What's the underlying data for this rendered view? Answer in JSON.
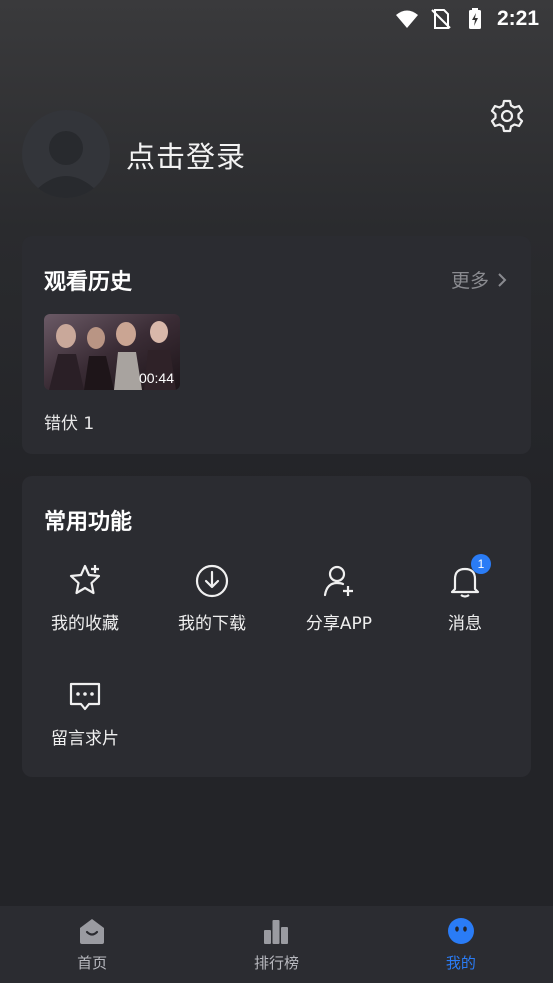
{
  "status_bar": {
    "time": "2:21"
  },
  "profile": {
    "login_label": "点击登录"
  },
  "history": {
    "title": "观看历史",
    "more_label": "更多",
    "items": [
      {
        "title": "错伏 1",
        "duration": "00:44"
      }
    ]
  },
  "functions": {
    "title": "常用功能",
    "items": [
      {
        "label": "我的收藏",
        "icon": "star-plus-icon"
      },
      {
        "label": "我的下载",
        "icon": "download-icon"
      },
      {
        "label": "分享APP",
        "icon": "add-user-icon"
      },
      {
        "label": "消息",
        "icon": "bell-icon",
        "badge": "1"
      },
      {
        "label": "留言求片",
        "icon": "chat-bubble-icon"
      }
    ]
  },
  "bottom_nav": {
    "items": [
      {
        "label": "首页",
        "icon": "home-icon",
        "active": false
      },
      {
        "label": "排行榜",
        "icon": "bar-chart-icon",
        "active": false
      },
      {
        "label": "我的",
        "icon": "smiley-profile-icon",
        "active": true
      }
    ]
  },
  "colors": {
    "accent": "#2a7cf6",
    "card_bg": "#2b2c31",
    "page_bg": "#232428"
  }
}
